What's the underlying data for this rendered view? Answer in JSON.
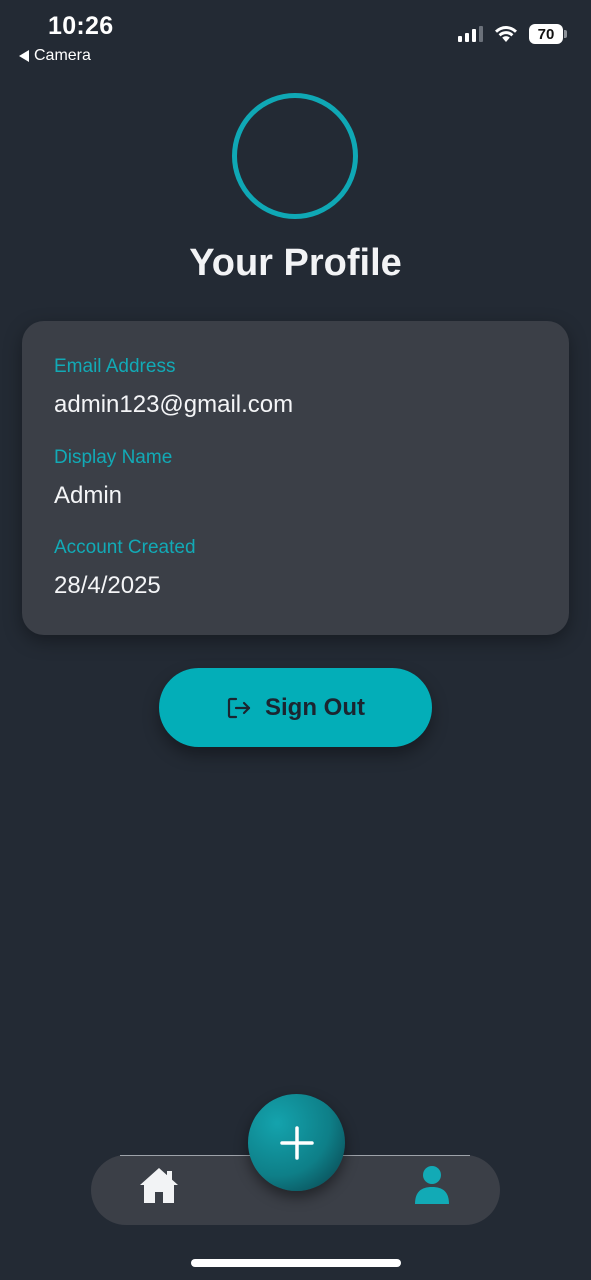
{
  "status_bar": {
    "time": "10:26",
    "back_label": "Camera",
    "battery": "70"
  },
  "profile": {
    "title": "Your Profile",
    "fields": [
      {
        "label": "Email Address",
        "value": "admin123@gmail.com"
      },
      {
        "label": "Display Name",
        "value": "Admin"
      },
      {
        "label": "Account Created",
        "value": "28/4/2025"
      }
    ]
  },
  "actions": {
    "sign_out_label": "Sign Out",
    "sign_out_icon": "logout-icon"
  },
  "nav": {
    "items": [
      {
        "icon": "home-icon",
        "active": false
      },
      {
        "icon": "plus-icon",
        "active": false
      },
      {
        "icon": "user-icon",
        "active": true
      }
    ]
  },
  "colors": {
    "background": "#232a34",
    "card": "#3b3f47",
    "accent": "#03aeb8",
    "label": "#12aab6",
    "text": "#f4f5f7"
  }
}
